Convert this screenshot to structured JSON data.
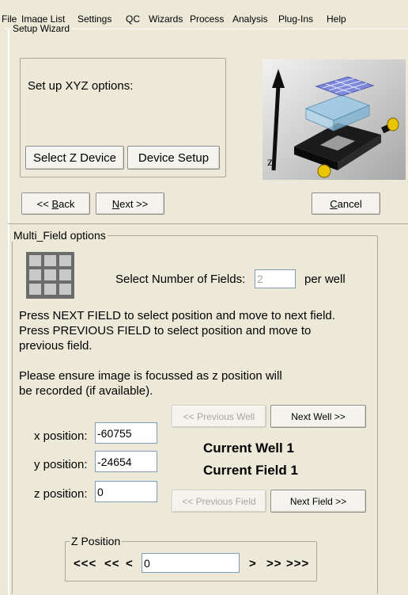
{
  "menu": [
    "File",
    "Image List",
    "Settings",
    "QC",
    "Wizards",
    "Process",
    "Analysis",
    "Plug-Ins",
    "Help"
  ],
  "window_title": "Setup Wizard",
  "setup": {
    "prompt": "Set up XYZ options:",
    "select_z_device": "Select Z Device",
    "device_setup": "Device Setup",
    "illustration_axis_label": "z"
  },
  "nav": {
    "back_prefix": "<< ",
    "back_mnemonic": "B",
    "back_rest": "ack",
    "next_mnemonic": "N",
    "next_rest": "ext >>",
    "cancel_mnemonic": "C",
    "cancel_rest": "ancel"
  },
  "multi_field": {
    "group_title": "Multi_Field options",
    "fields_label": "Select Number of Fields:",
    "fields_value": "2",
    "fields_suffix": "per well",
    "instruction_1": "Press NEXT FIELD to select position and move to next field.",
    "instruction_2a": "Press PREVIOUS FIELD to select position and move to",
    "instruction_2b": "previous field.",
    "focus_note_1": "Please ensure image is focussed as z position will",
    "focus_note_2": "be recorded (if available).",
    "previous_well": "<< Previous Well",
    "next_well": "Next Well >>",
    "previous_field": "<< Previous Field",
    "next_field": "Next Field >>",
    "current_well": "Current Well 1",
    "current_field": "Current Field 1",
    "x_label": "x position:",
    "x_value": "-60755",
    "y_label": "y position:",
    "y_value": "-24654",
    "z_label": "z position:",
    "z_value": "0"
  },
  "z_position": {
    "group_title": "Z Position",
    "step_down_large": "<<<",
    "step_down_medium": "<<",
    "step_down_small": "<",
    "value": "0",
    "step_up_small": ">",
    "step_up_medium": ">>",
    "step_up_large": ">>>"
  }
}
